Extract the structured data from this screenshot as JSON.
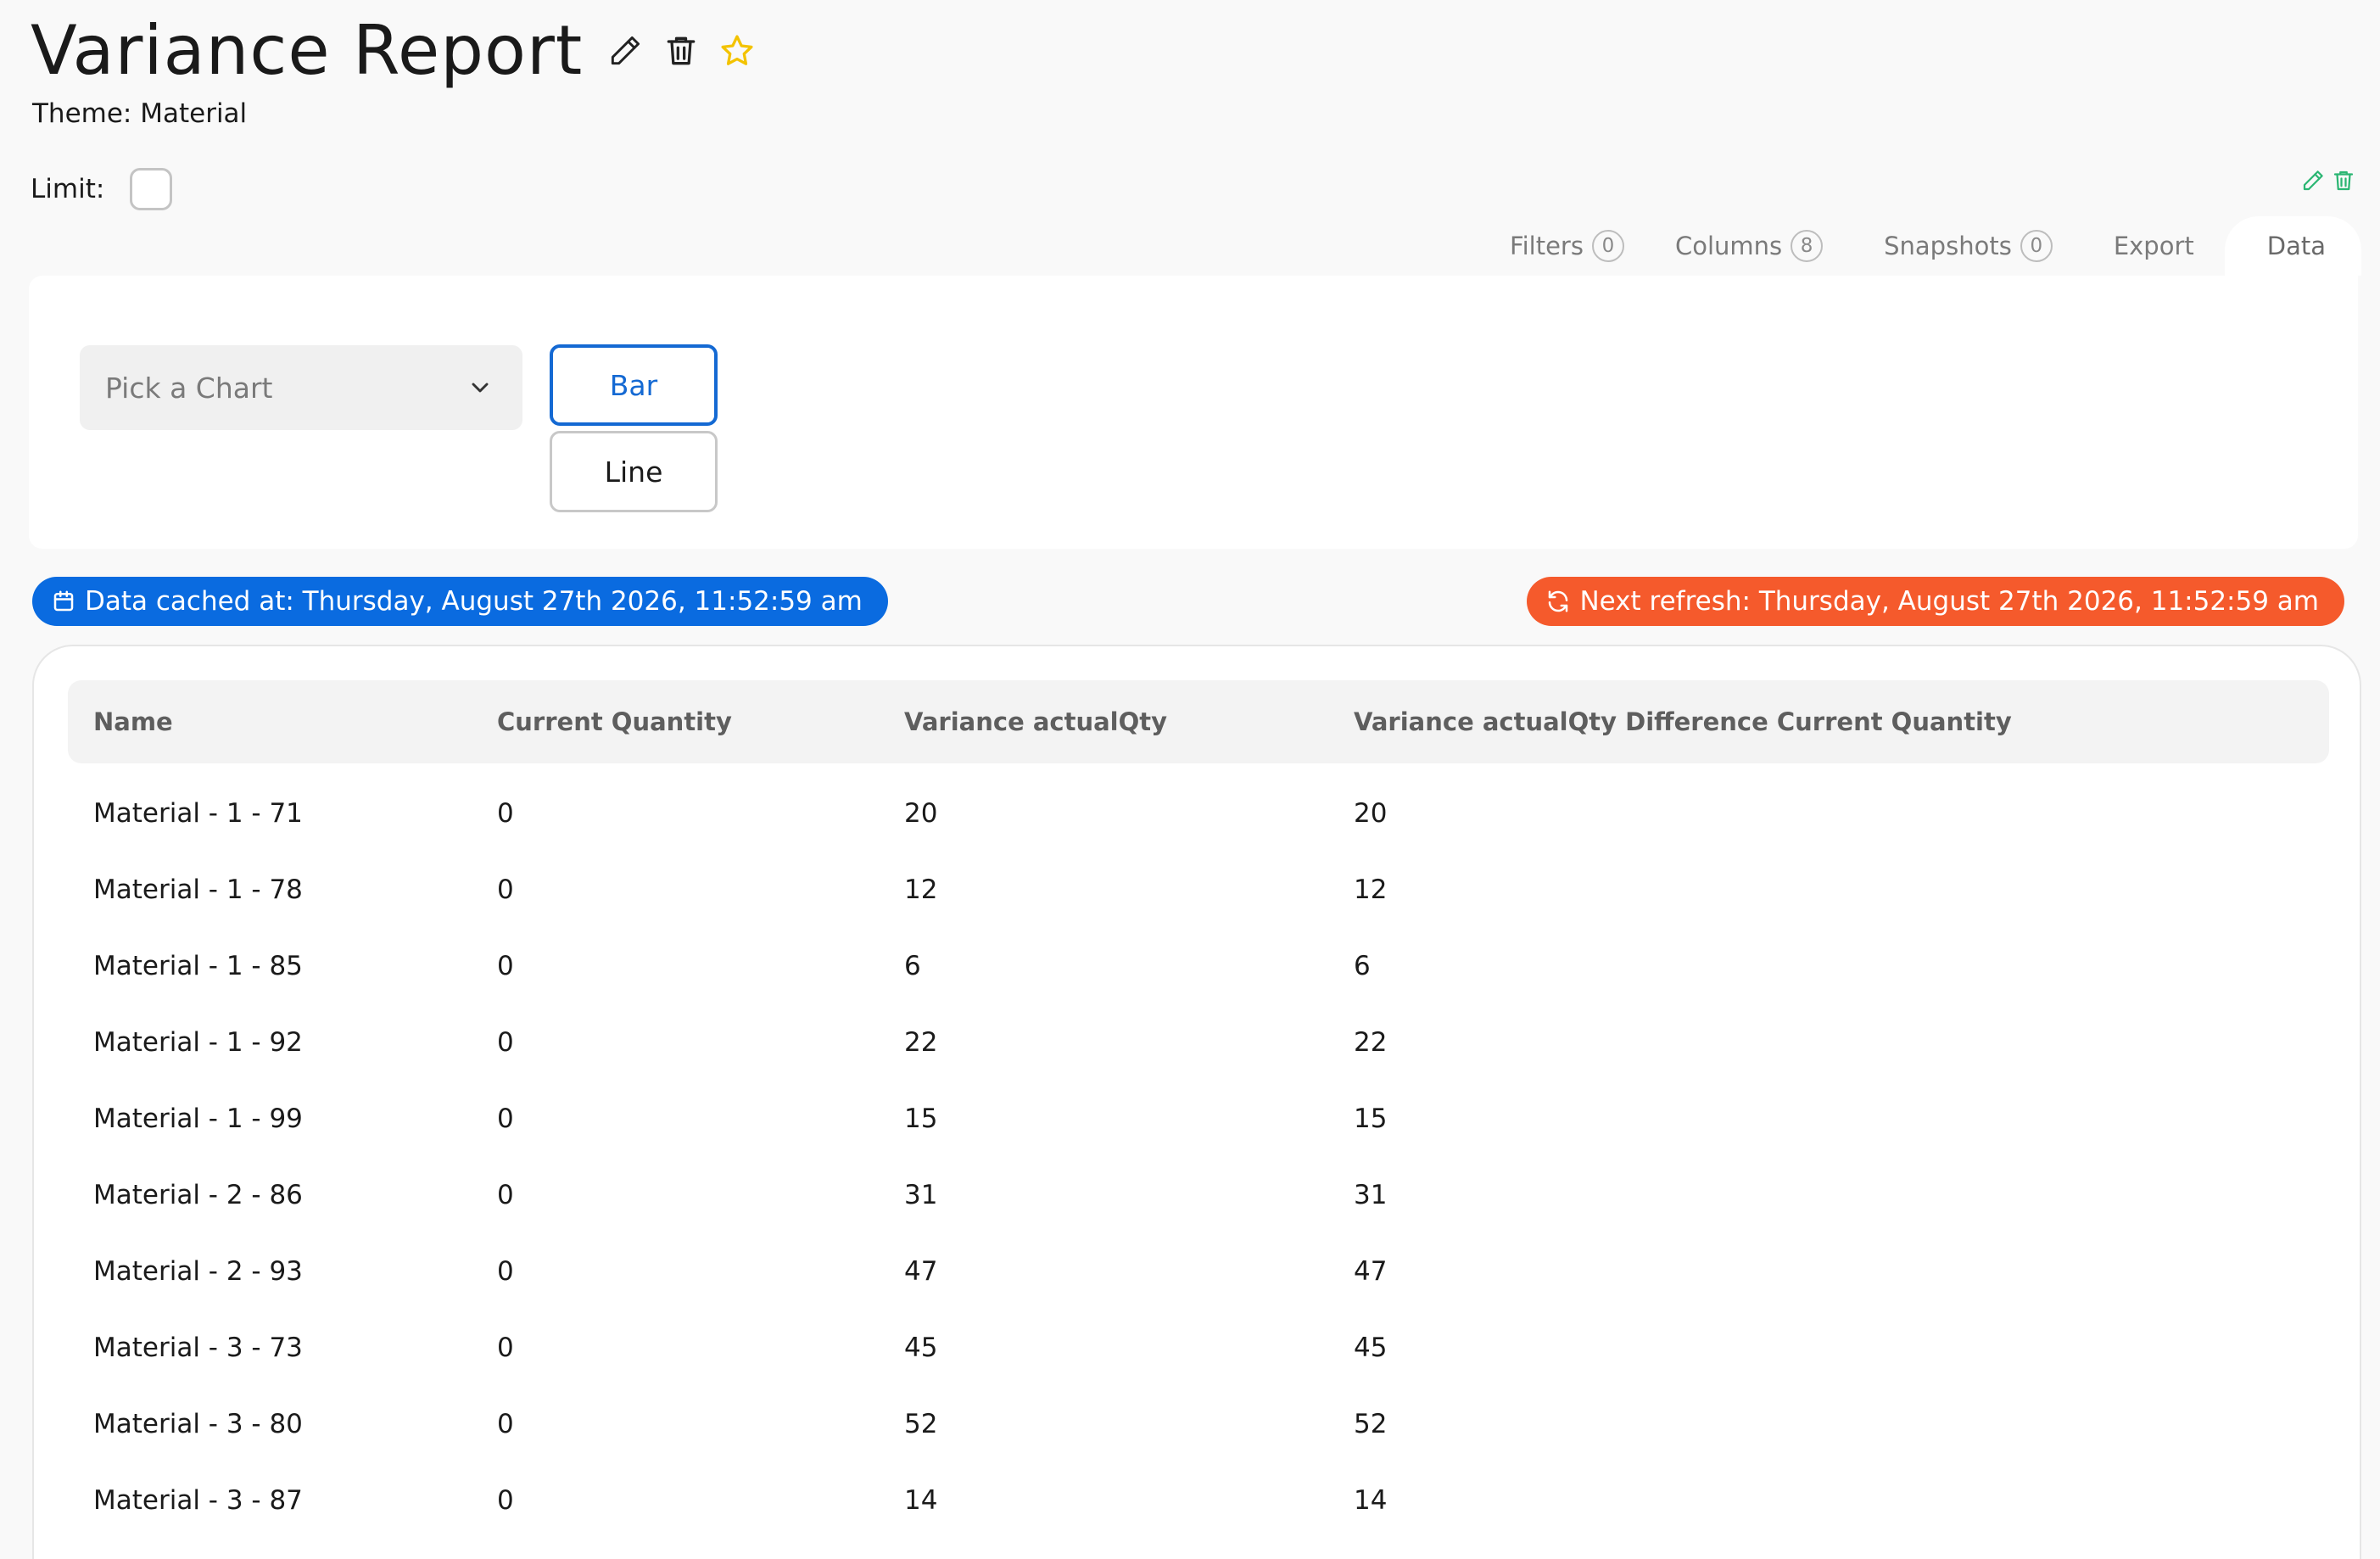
{
  "header": {
    "title": "Variance Report",
    "theme_label": "Theme: Material",
    "limit_label": "Limit:",
    "star_color": "#f3c300"
  },
  "tabs": [
    {
      "label": "Filters",
      "count": "0"
    },
    {
      "label": "Columns",
      "count": "8"
    },
    {
      "label": "Snapshots",
      "count": "0"
    },
    {
      "label": "Export"
    },
    {
      "label": "Data",
      "active": true
    }
  ],
  "chart": {
    "picker_placeholder": "Pick a Chart",
    "bar_label": "Bar",
    "line_label": "Line",
    "selected": "Bar"
  },
  "badges": {
    "cached": "Data cached at: Thursday, August 27th 2026, 11:52:59 am",
    "refresh": "Next refresh: Thursday, August 27th 2026, 11:52:59 am",
    "cached_color": "#0a6be0",
    "refresh_color": "#f55a2c"
  },
  "table": {
    "columns": [
      "Name",
      "Current Quantity",
      "Variance actualQty",
      "Variance actualQty Difference Current Quantity"
    ],
    "rows": [
      [
        "Material - 1 - 71",
        "0",
        "20",
        "20"
      ],
      [
        "Material - 1 - 78",
        "0",
        "12",
        "12"
      ],
      [
        "Material - 1 - 85",
        "0",
        "6",
        "6"
      ],
      [
        "Material - 1 - 92",
        "0",
        "22",
        "22"
      ],
      [
        "Material - 1 - 99",
        "0",
        "15",
        "15"
      ],
      [
        "Material - 2 - 86",
        "0",
        "31",
        "31"
      ],
      [
        "Material - 2 - 93",
        "0",
        "47",
        "47"
      ],
      [
        "Material - 3 - 73",
        "0",
        "45",
        "45"
      ],
      [
        "Material - 3 - 80",
        "0",
        "52",
        "52"
      ],
      [
        "Material - 3 - 87",
        "0",
        "14",
        "14"
      ]
    ]
  }
}
